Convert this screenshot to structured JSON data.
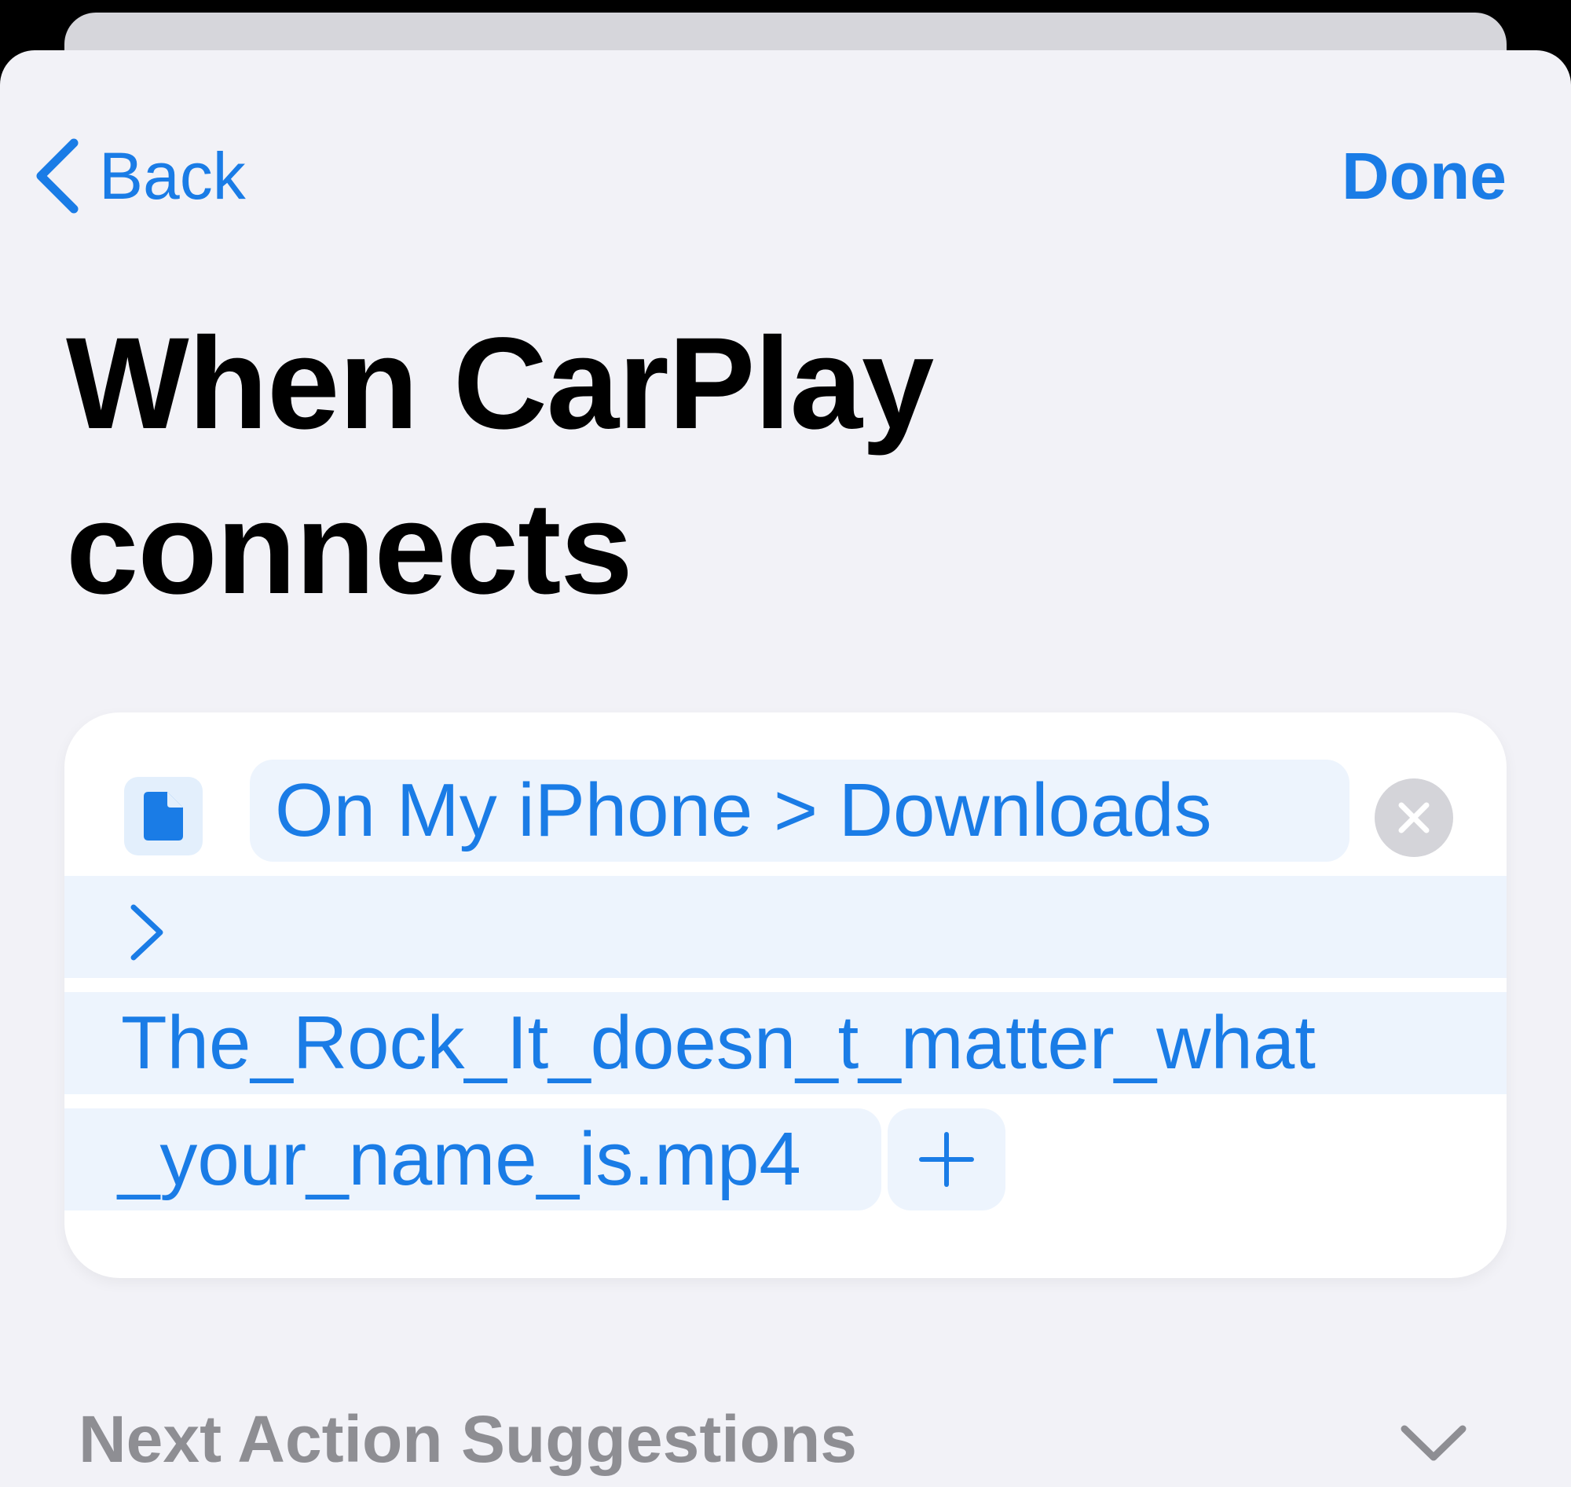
{
  "nav": {
    "back_label": "Back",
    "done_label": "Done",
    "back_icon": "chevron-left-icon"
  },
  "title": {
    "line1": "When CarPlay",
    "line2": "connects"
  },
  "action": {
    "icon": "document-icon",
    "path_prefix": "On My iPhone",
    "separator": ">",
    "folder": "Downloads",
    "file_line1": "The_Rock_It_doesn_t_matter_what",
    "file_line2": "_your_name_is.mp4",
    "clear_icon": "close-circle-icon",
    "add_icon": "plus-icon"
  },
  "suggestions": {
    "label": "Next Action Suggestions",
    "icon": "chevron-down-icon"
  },
  "colors": {
    "accent": "#1a7ce6",
    "background": "#f2f2f7",
    "card": "#ffffff",
    "token": "#edf4fd",
    "secondary_text": "#8e8e93"
  }
}
